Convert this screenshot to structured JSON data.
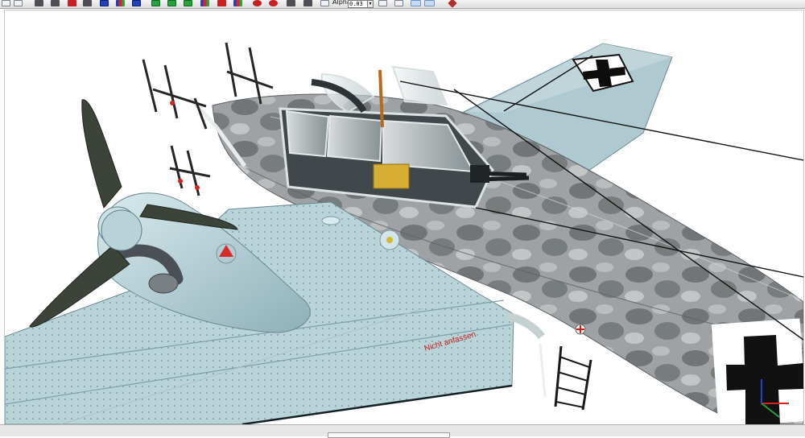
{
  "toolbar": {
    "alpha_label": "Alpha:",
    "alpha_value": "0.03"
  },
  "viewport": {
    "decal_text": "Nicht anfassen"
  },
  "status": {
    "text": ""
  },
  "colors": {
    "toolbar_bg": "#e6e6e6",
    "sky_blue_panel": "#b7d3d8",
    "camo_gray": "#8e9094",
    "propeller": "#3c4339"
  }
}
